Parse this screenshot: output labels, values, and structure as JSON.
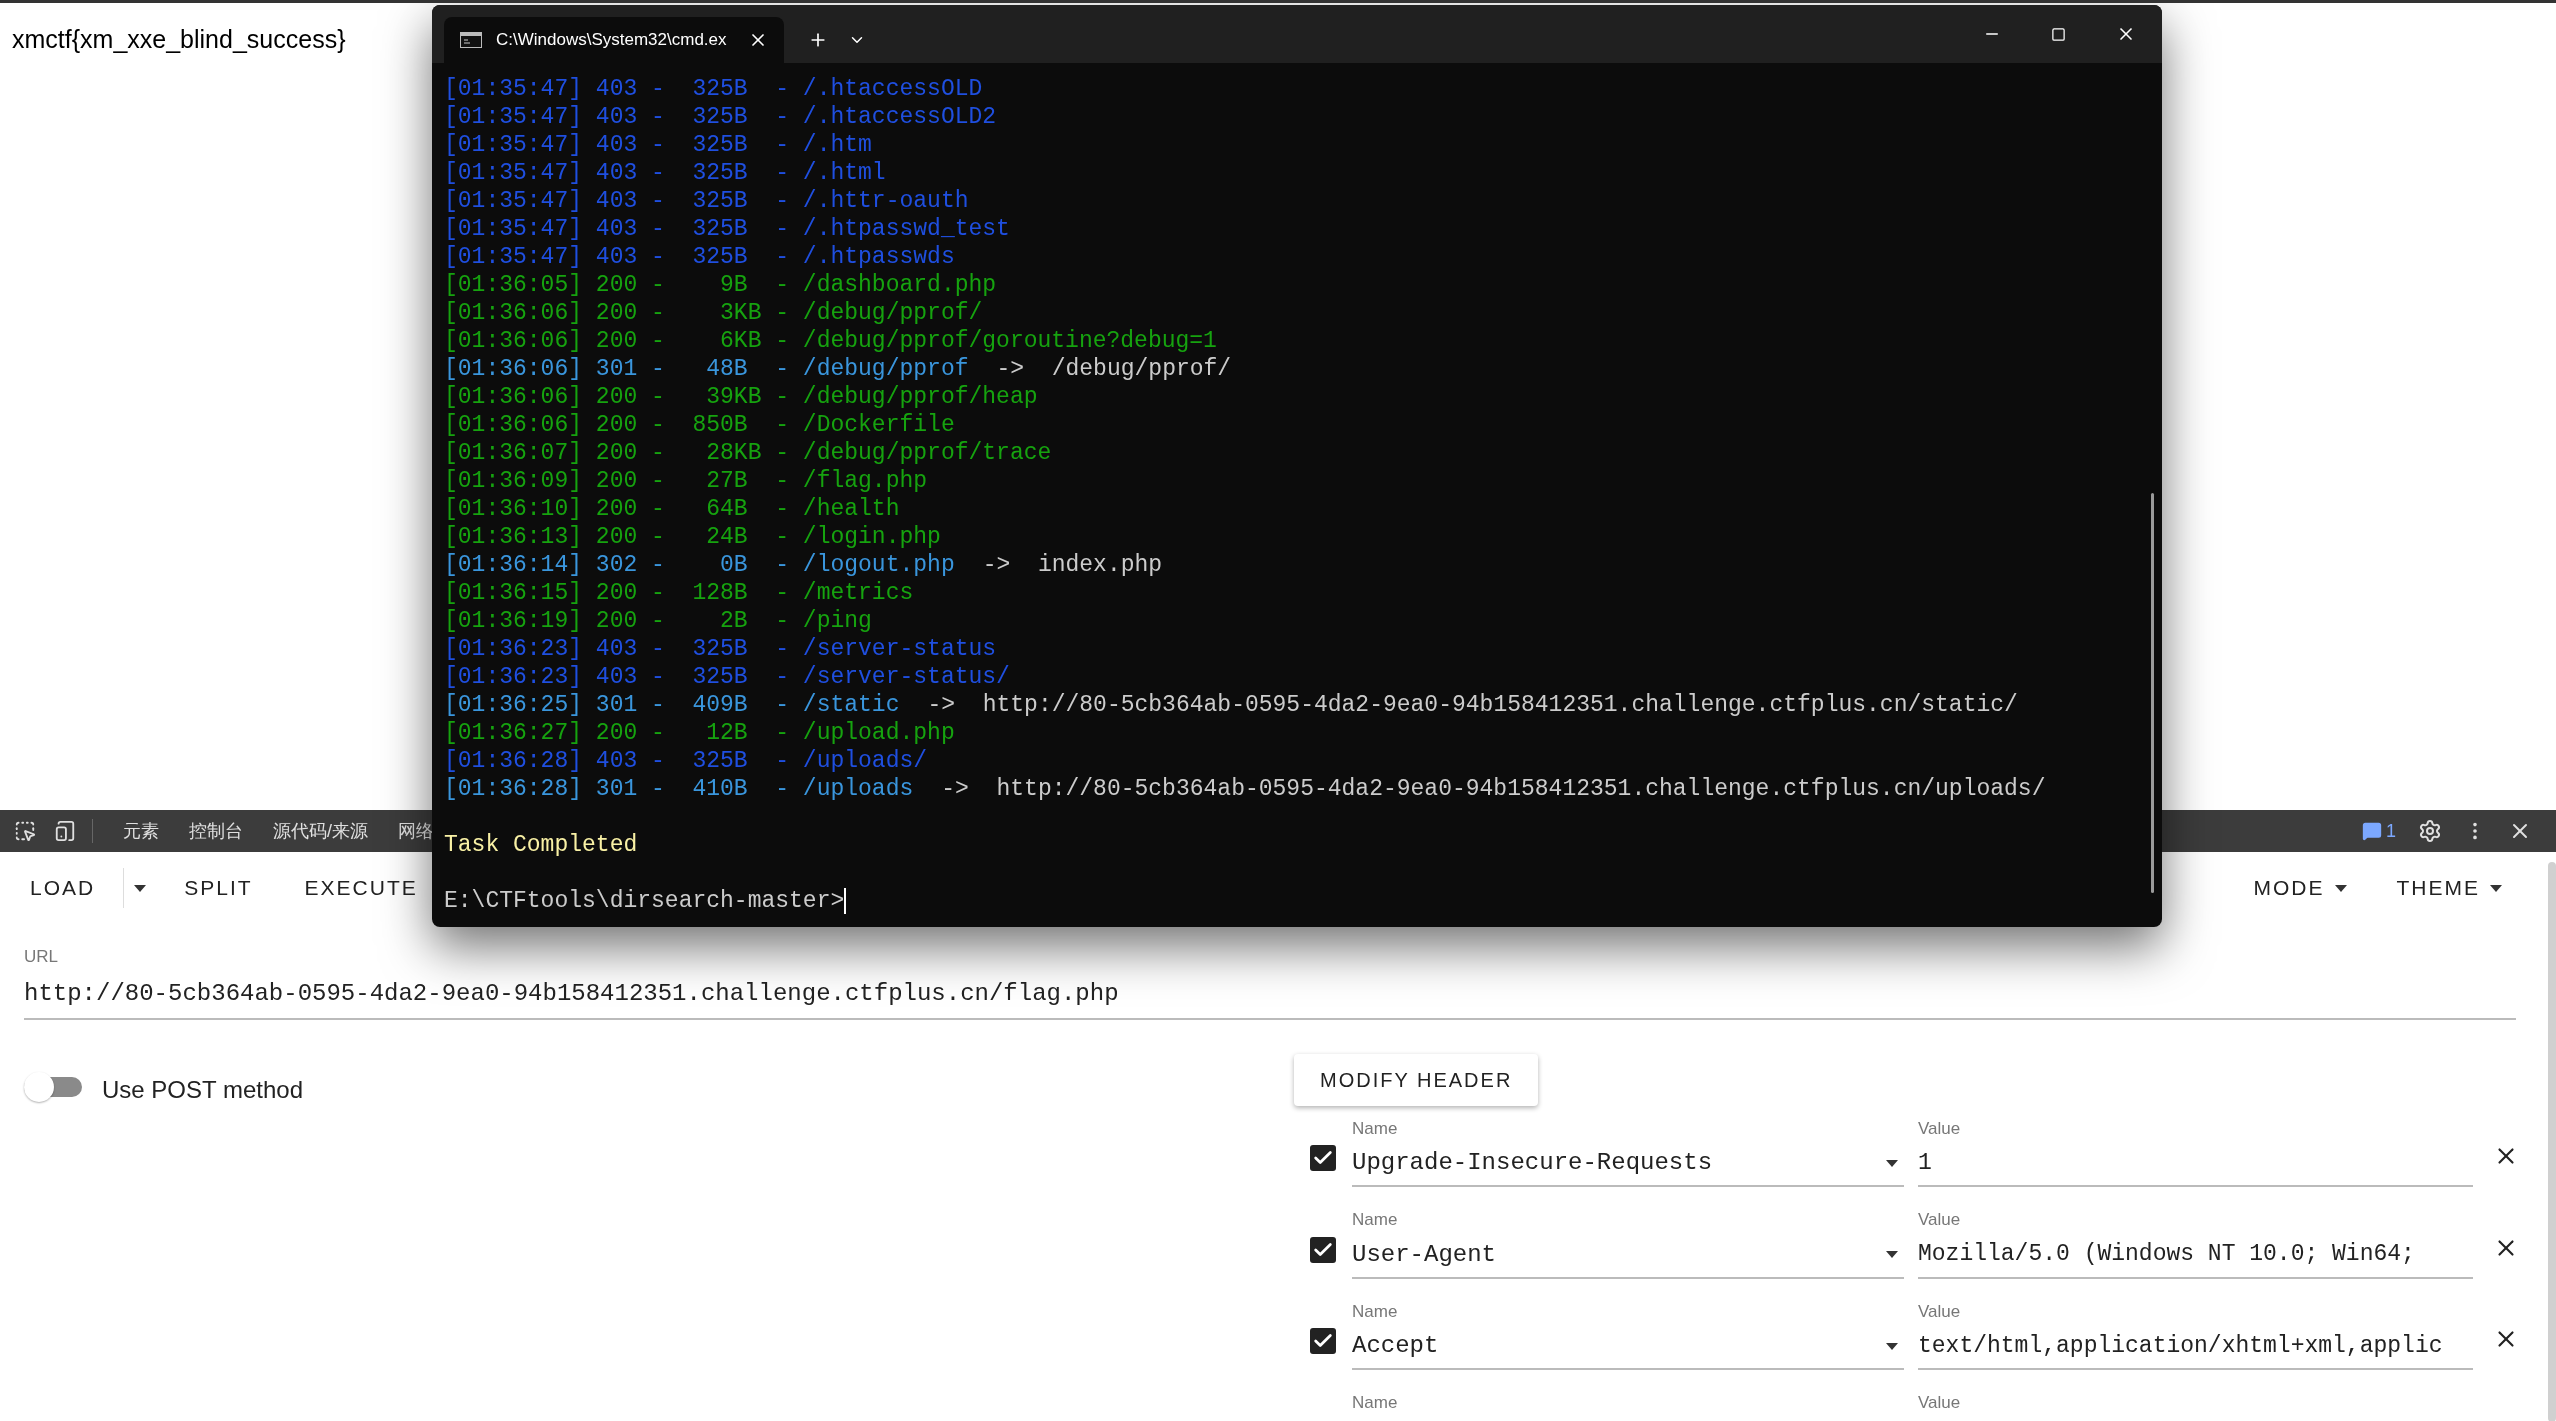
{
  "page_text": "xmctf{xm_xxe_blind_success}",
  "devtools": {
    "tabs": [
      "元素",
      "控制台",
      "源代码/来源",
      "网络"
    ],
    "message_count": "1"
  },
  "hackbar": {
    "toolbar_left": [
      {
        "label": "LOAD",
        "kind": "dropdown"
      },
      {
        "label": "SPLIT",
        "kind": "plain"
      },
      {
        "label": "EXECUTE",
        "kind": "plain"
      }
    ],
    "toolbar_right": [
      "MODE",
      "THEME"
    ],
    "url": {
      "label": "URL",
      "value": "http://80-5cb364ab-0595-4da2-9ea0-94b158412351.challenge.ctfplus.cn/flag.php"
    },
    "post_toggle": {
      "label": "Use POST method",
      "on": false
    },
    "modify_header_button": "MODIFY HEADER",
    "headers": [
      {
        "enabled": true,
        "name_label": "Name",
        "name": "Upgrade-Insecure-Requests",
        "value_label": "Value",
        "value": "1"
      },
      {
        "enabled": true,
        "name_label": "Name",
        "name": "User-Agent",
        "value_label": "Value",
        "value": "Mozilla/5.0 (Windows NT 10.0; Win64;"
      },
      {
        "enabled": true,
        "name_label": "Name",
        "name": "Accept",
        "value_label": "Value",
        "value": "text/html,application/xhtml+xml,applic"
      }
    ],
    "partial_header": {
      "name_label": "Name",
      "value_label": "Value"
    }
  },
  "terminal": {
    "tab_title": "C:\\Windows\\System32\\cmd.ex",
    "lines": [
      {
        "text": "[01:35:47] 403 -  325B  - /.htaccessOLD",
        "color": "#1f4fe0"
      },
      {
        "text": "[01:35:47] 403 -  325B  - /.htaccessOLD2",
        "color": "#1f4fe0"
      },
      {
        "text": "[01:35:47] 403 -  325B  - /.htm",
        "color": "#1f4fe0"
      },
      {
        "text": "[01:35:47] 403 -  325B  - /.html",
        "color": "#1f4fe0"
      },
      {
        "text": "[01:35:47] 403 -  325B  - /.httr-oauth",
        "color": "#1f4fe0"
      },
      {
        "text": "[01:35:47] 403 -  325B  - /.htpasswd_test",
        "color": "#1f4fe0"
      },
      {
        "text": "[01:35:47] 403 -  325B  - /.htpasswds",
        "color": "#1f4fe0"
      },
      {
        "text": "[01:36:05] 200 -    9B  - /dashboard.php",
        "color": "#16a30f"
      },
      {
        "text": "[01:36:06] 200 -    3KB - /debug/pprof/",
        "color": "#16a30f"
      },
      {
        "text": "[01:36:06] 200 -    6KB - /debug/pprof/goroutine?debug=1",
        "color": "#16a30f"
      },
      {
        "text": "[01:36:06] 301 -   48B  - /debug/pprof",
        "color": "#3a96dd",
        "redirect": "->  /debug/pprof/"
      },
      {
        "text": "[01:36:06] 200 -   39KB - /debug/pprof/heap",
        "color": "#16a30f"
      },
      {
        "text": "[01:36:06] 200 -  850B  - /Dockerfile",
        "color": "#16a30f"
      },
      {
        "text": "[01:36:07] 200 -   28KB - /debug/pprof/trace",
        "color": "#16a30f"
      },
      {
        "text": "[01:36:09] 200 -   27B  - /flag.php",
        "color": "#16a30f"
      },
      {
        "text": "[01:36:10] 200 -   64B  - /health",
        "color": "#16a30f"
      },
      {
        "text": "[01:36:13] 200 -   24B  - /login.php",
        "color": "#16a30f"
      },
      {
        "text": "[01:36:14] 302 -    0B  - /logout.php",
        "color": "#3a96dd",
        "redirect": "->  index.php"
      },
      {
        "text": "[01:36:15] 200 -  128B  - /metrics",
        "color": "#16a30f"
      },
      {
        "text": "[01:36:19] 200 -    2B  - /ping",
        "color": "#16a30f"
      },
      {
        "text": "[01:36:23] 403 -  325B  - /server-status",
        "color": "#1f4fe0"
      },
      {
        "text": "[01:36:23] 403 -  325B  - /server-status/",
        "color": "#1f4fe0"
      },
      {
        "text": "[01:36:25] 301 -  409B  - /static",
        "color": "#3a96dd",
        "redirect": "->  http://80-5cb364ab-0595-4da2-9ea0-94b158412351.challenge.ctfplus.cn/static/"
      },
      {
        "text": "[01:36:27] 200 -   12B  - /upload.php",
        "color": "#16a30f"
      },
      {
        "text": "[01:36:28] 403 -  325B  - /uploads/",
        "color": "#1f4fe0"
      },
      {
        "text": "[01:36:28] 301 -  410B  - /uploads",
        "color": "#3a96dd",
        "redirect": "->  http://80-5cb364ab-0595-4da2-9ea0-94b158412351.challenge.ctfplus.cn/uploads/"
      }
    ],
    "status": "Task Completed",
    "prompt": "E:\\CTFtools\\dirsearch-master>"
  }
}
